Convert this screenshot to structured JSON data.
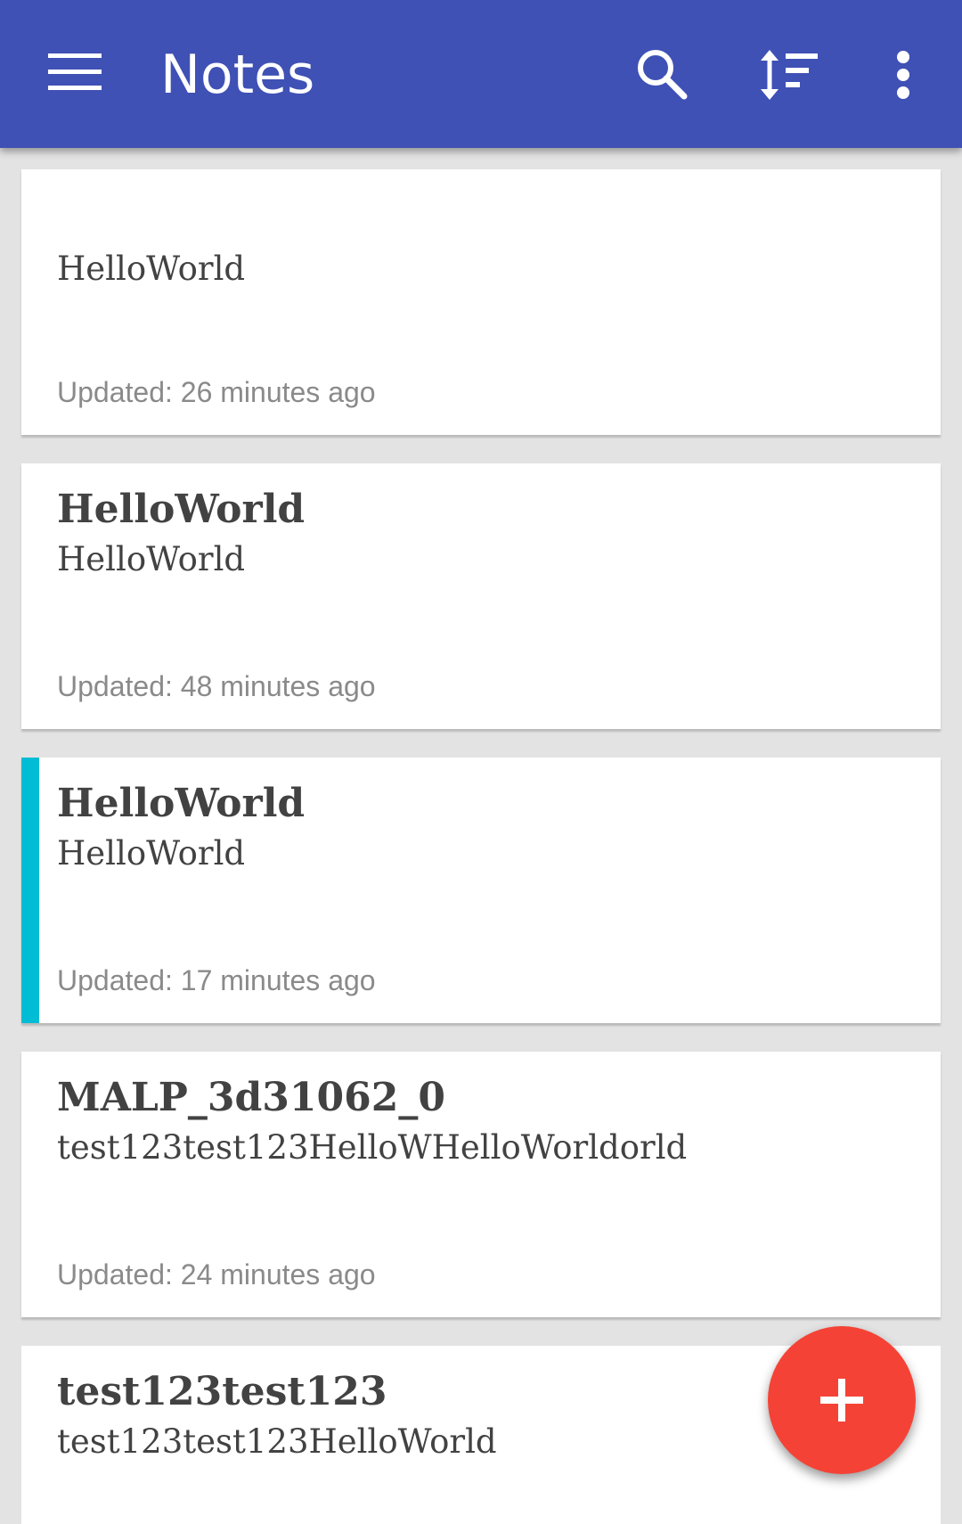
{
  "appbar": {
    "title": "Notes",
    "color": "#3f51b5",
    "icons": [
      "menu-icon",
      "search-icon",
      "sort-icon",
      "more-vert-icon"
    ]
  },
  "notes": [
    {
      "title": "",
      "body": "HelloWorld",
      "updated": "Updated: 26 minutes ago",
      "accent_color": ""
    },
    {
      "title": "HelloWorld",
      "body": "HelloWorld",
      "updated": "Updated: 48 minutes ago",
      "accent_color": ""
    },
    {
      "title": "HelloWorld",
      "body": "HelloWorld",
      "updated": "Updated: 17 minutes ago",
      "accent_color": "#00bcd4"
    },
    {
      "title": "MALP_3d31062_0",
      "body": "test123test123HelloWHelloWorldorld",
      "updated": "Updated: 24 minutes ago",
      "accent_color": ""
    },
    {
      "title": "test123test123",
      "body": "test123test123HelloWorld",
      "updated": "",
      "accent_color": ""
    }
  ],
  "fab": {
    "icon": "add-icon",
    "color": "#f44336"
  }
}
